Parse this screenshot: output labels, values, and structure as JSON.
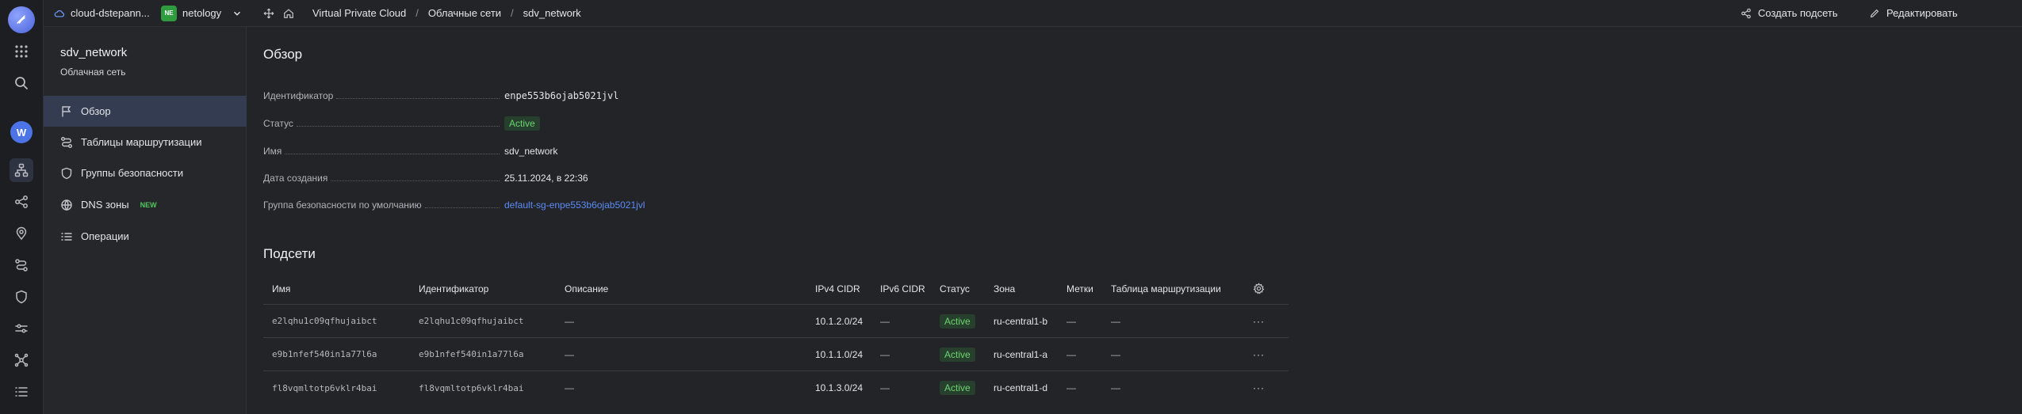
{
  "topbar": {
    "cloud_name": "cloud-dstepann...",
    "org_badge": "NE",
    "org_name": "netology",
    "breadcrumbs": [
      "Virtual Private Cloud",
      "Облачные сети",
      "sdv_network"
    ],
    "separator": "/",
    "create_subnet_label": "Создать подсеть",
    "edit_label": "Редактировать",
    "more_label": "···"
  },
  "rail": {
    "avatar_letter": "W"
  },
  "sidebar": {
    "title": "sdv_network",
    "subtitle": "Облачная сеть",
    "items": [
      {
        "label": "Обзор",
        "icon": "flag-icon",
        "active": true
      },
      {
        "label": "Таблицы маршрутизации",
        "icon": "route-icon"
      },
      {
        "label": "Группы безопасности",
        "icon": "shield-icon"
      },
      {
        "label": "DNS зоны",
        "icon": "globe-icon",
        "badge": "NEW"
      },
      {
        "label": "Операции",
        "icon": "list-icon"
      }
    ]
  },
  "overview": {
    "heading": "Обзор",
    "props": [
      {
        "key": "Идентификатор",
        "value": "enpe553b6ojab5021jvl"
      },
      {
        "key": "Статус",
        "value": "Active"
      },
      {
        "key": "Имя",
        "value": "sdv_network"
      },
      {
        "key": "Дата создания",
        "value": "25.11.2024, в 22:36"
      },
      {
        "key": "Группа безопасности по умолчанию",
        "value": "default-sg-enpe553b6ojab5021jvl"
      }
    ]
  },
  "subnets": {
    "heading": "Подсети",
    "columns": [
      "Имя",
      "Идентификатор",
      "Описание",
      "IPv4 CIDR",
      "IPv6 CIDR",
      "Статус",
      "Зона",
      "Метки",
      "Таблица маршрутизации"
    ],
    "rows": [
      {
        "name": "e2lqhu1c09qfhujaibct",
        "id": "e2lqhu1c09qfhujaibct",
        "desc": "—",
        "ipv4": "10.1.2.0/24",
        "ipv6": "—",
        "status": "Active",
        "zone": "ru-central1-b",
        "labels": "—",
        "route": "—"
      },
      {
        "name": "e9b1nfef540in1a77l6a",
        "id": "e9b1nfef540in1a77l6a",
        "desc": "—",
        "ipv4": "10.1.1.0/24",
        "ipv6": "—",
        "status": "Active",
        "zone": "ru-central1-a",
        "labels": "—",
        "route": "—"
      },
      {
        "name": "fl8vqmltotp6vklr4bai",
        "id": "fl8vqmltotp6vklr4bai",
        "desc": "—",
        "ipv4": "10.1.3.0/24",
        "ipv6": "—",
        "status": "Active",
        "zone": "ru-central1-d",
        "labels": "—",
        "route": "—"
      }
    ],
    "row_menu": "···"
  },
  "colors": {
    "background": "#232427",
    "accent": "#5b8cf6",
    "status_active": "#6bd470"
  }
}
